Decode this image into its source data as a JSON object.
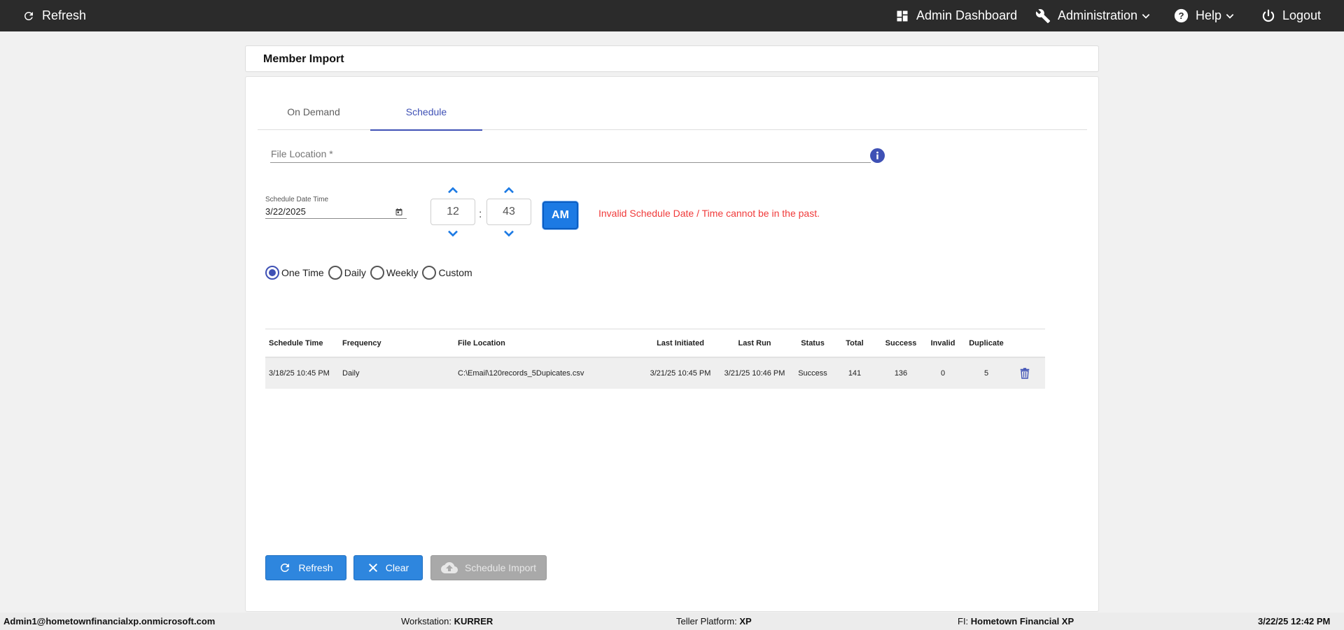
{
  "topbar": {
    "refresh_label": "Refresh",
    "dashboard_label": "Admin Dashboard",
    "administration_label": "Administration",
    "help_label": "Help",
    "logout_label": "Logout"
  },
  "page": {
    "title": "Member Import"
  },
  "tabs": [
    {
      "label": "On Demand",
      "active": false
    },
    {
      "label": "Schedule",
      "active": true
    }
  ],
  "form": {
    "file_location_placeholder": "File Location *",
    "file_location_value": "",
    "schedule_label": "Schedule Date Time",
    "schedule_date": "3/22/2025",
    "hour": "12",
    "minute": "43",
    "ampm": "AM",
    "time_separator": ":",
    "error": "Invalid Schedule Date / Time cannot be in the past."
  },
  "frequency_options": [
    {
      "label": "One Time",
      "selected": true
    },
    {
      "label": "Daily",
      "selected": false
    },
    {
      "label": "Weekly",
      "selected": false
    },
    {
      "label": "Custom",
      "selected": false
    }
  ],
  "table": {
    "headers": [
      "Schedule Time",
      "Frequency",
      "File Location",
      "Last Initiated",
      "Last Run",
      "Status",
      "Total",
      "Success",
      "Invalid",
      "Duplicate"
    ],
    "rows": [
      [
        "3/18/25 10:45 PM",
        "Daily",
        "C:\\Email\\120records_5Dupicates.csv",
        "3/21/25 10:45 PM",
        "3/21/25 10:46 PM",
        "Success",
        "141",
        "136",
        "0",
        "5"
      ]
    ]
  },
  "buttons": {
    "refresh": "Refresh",
    "clear": "Clear",
    "schedule_import": "Schedule Import"
  },
  "footer": {
    "user": "Admin1@hometownfinancialxp.onmicrosoft.com",
    "workstation_label": "Workstation:",
    "workstation": "KURRER",
    "teller_platform_label": "Teller Platform:",
    "teller_platform": "XP",
    "fi_label": "FI:",
    "fi": "Hometown Financial XP",
    "datetime": "3/22/25 12:42 PM"
  },
  "colors": {
    "topbar": "#2b2b2b",
    "accent": "#3f51b5",
    "button_blue": "#2e86de",
    "error": "#f03a3a",
    "ampm": "#1c7ae4"
  }
}
